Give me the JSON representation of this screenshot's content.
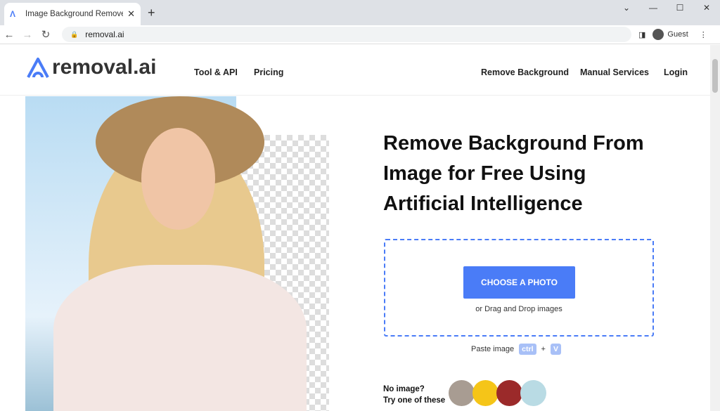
{
  "browser": {
    "tab_title": "Image Background Remover | Removal.AI",
    "url": "removal.ai",
    "profile": "Guest"
  },
  "header": {
    "logo": "removal.ai",
    "nav_left": [
      "Tool & API",
      "Pricing"
    ],
    "nav_right": [
      "Remove Background",
      "Manual Services",
      "Login"
    ]
  },
  "hero": {
    "title": "Remove Background From Image for Free Using Artificial Intelligence",
    "choose_button": "CHOOSE A PHOTO",
    "drag_text": "or Drag and Drop images",
    "paste_label": "Paste image",
    "key_ctrl": "ctrl",
    "plus": "+",
    "key_v": "V",
    "no_image": "No image?",
    "try_text": "Try one of these"
  },
  "colors": {
    "accent": "#4a7cf7"
  }
}
